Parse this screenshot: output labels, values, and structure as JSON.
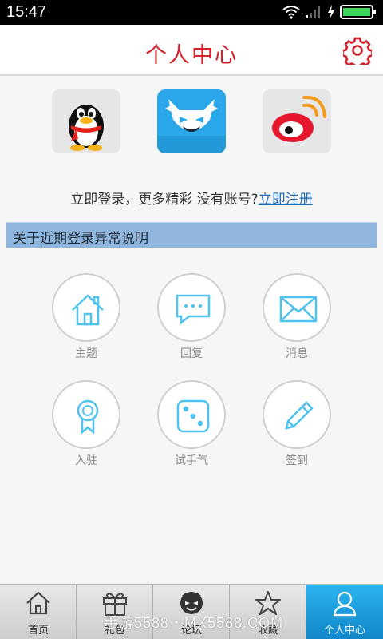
{
  "status_bar": {
    "time": "15:47"
  },
  "header": {
    "title": "个人中心"
  },
  "social_login": {
    "items": [
      {
        "name": "QQ"
      },
      {
        "name": "xiaoji"
      },
      {
        "name": "Weibo"
      }
    ]
  },
  "login": {
    "prompt": "立即登录，更多精彩 没有账号?",
    "register_link": "立即注册"
  },
  "notice": {
    "text": "关于近期登录异常说明"
  },
  "grid": [
    {
      "label": "主题",
      "icon": "home-icon"
    },
    {
      "label": "回复",
      "icon": "chat-icon"
    },
    {
      "label": "消息",
      "icon": "mail-icon"
    },
    {
      "label": "入驻",
      "icon": "ribbon-icon"
    },
    {
      "label": "试手气",
      "icon": "dice-icon"
    },
    {
      "label": "签到",
      "icon": "pencil-icon"
    }
  ],
  "tabs": [
    {
      "label": "首页"
    },
    {
      "label": "礼包"
    },
    {
      "label": "论坛"
    },
    {
      "label": "收藏"
    },
    {
      "label": "个人中心",
      "active": true
    }
  ],
  "watermark": "手游5588・MX5588.COM",
  "colors": {
    "title": "#d4222b",
    "accent_blue": "#2aa7ea",
    "icon_blue": "#4fc3ef",
    "notice_bg": "#8fb7dd",
    "link": "#1f6bb8"
  }
}
